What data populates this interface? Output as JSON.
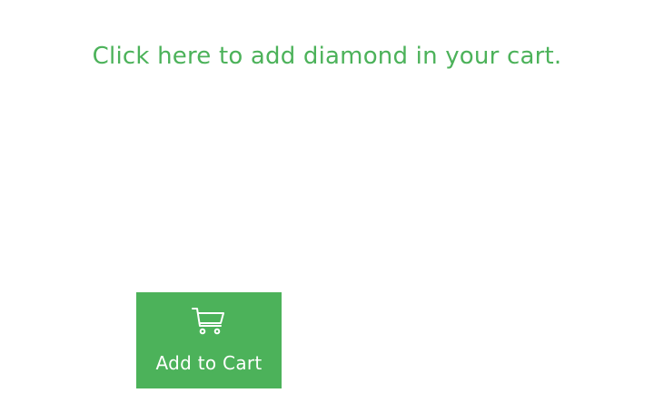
{
  "instruction": {
    "text": "Click here to add diamond in your cart."
  },
  "cart_button": {
    "label": "Add to Cart",
    "icon": "shopping-cart-icon"
  },
  "colors": {
    "accent": "#4cb25a",
    "background": "#ffffff",
    "button_text": "#ffffff"
  }
}
